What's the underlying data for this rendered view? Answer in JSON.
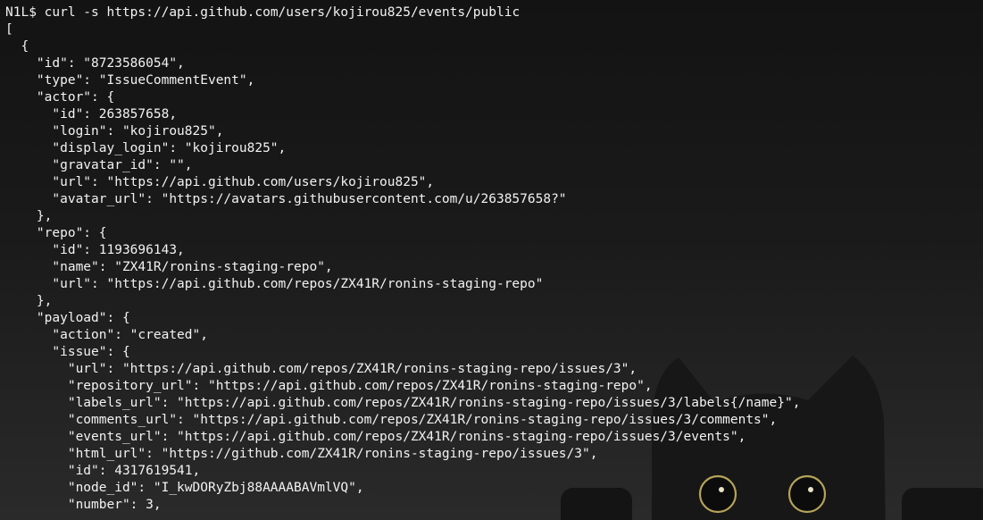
{
  "terminal": {
    "prompt": "N1L$",
    "command": "curl -s https://api.github.com/users/kojirou825/events/public",
    "output_lines": [
      "[",
      "  {",
      "    \"id\": \"8723586054\",",
      "    \"type\": \"IssueCommentEvent\",",
      "    \"actor\": {",
      "      \"id\": 263857658,",
      "      \"login\": \"kojirou825\",",
      "      \"display_login\": \"kojirou825\",",
      "      \"gravatar_id\": \"\",",
      "      \"url\": \"https://api.github.com/users/kojirou825\",",
      "      \"avatar_url\": \"https://avatars.githubusercontent.com/u/263857658?\"",
      "    },",
      "    \"repo\": {",
      "      \"id\": 1193696143,",
      "      \"name\": \"ZX41R/ronins-staging-repo\",",
      "      \"url\": \"https://api.github.com/repos/ZX41R/ronins-staging-repo\"",
      "    },",
      "    \"payload\": {",
      "      \"action\": \"created\",",
      "      \"issue\": {",
      "        \"url\": \"https://api.github.com/repos/ZX41R/ronins-staging-repo/issues/3\",",
      "        \"repository_url\": \"https://api.github.com/repos/ZX41R/ronins-staging-repo\",",
      "        \"labels_url\": \"https://api.github.com/repos/ZX41R/ronins-staging-repo/issues/3/labels{/name}\",",
      "        \"comments_url\": \"https://api.github.com/repos/ZX41R/ronins-staging-repo/issues/3/comments\",",
      "        \"events_url\": \"https://api.github.com/repos/ZX41R/ronins-staging-repo/issues/3/events\",",
      "        \"html_url\": \"https://github.com/ZX41R/ronins-staging-repo/issues/3\",",
      "        \"id\": 4317619541,",
      "        \"node_id\": \"I_kwDORyZbj88AAAABAVmlVQ\",",
      "        \"number\": 3,"
    ]
  },
  "colors": {
    "text": "#f2f2f2",
    "background": "#1c1c1c",
    "cat_eye_ring": "#b6a35a"
  },
  "wallpaper": {
    "icon": "black-cat-peeking-illustration"
  }
}
